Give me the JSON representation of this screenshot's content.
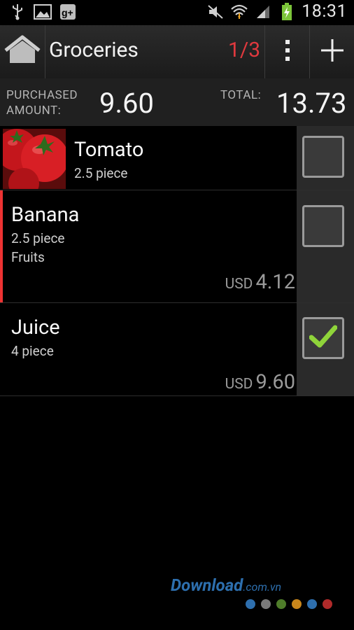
{
  "statusbar": {
    "time": "18:31",
    "left_icons": [
      "usb-icon",
      "image-icon",
      "google-plus-icon"
    ],
    "right_icons": [
      "mute-icon",
      "wifi-icon",
      "signal-icon",
      "battery-icon"
    ]
  },
  "actionbar": {
    "title": "Groceries",
    "counter": "1/3",
    "home_icon": "home-icon",
    "menu_icon": "overflow-menu-icon",
    "add_icon": "add-icon"
  },
  "summary": {
    "purchased_label_line1": "PURCHASED",
    "purchased_label_line2": "AMOUNT:",
    "purchased_value": "9.60",
    "total_label": "TOTAL:",
    "total_value": "13.73"
  },
  "items": [
    {
      "name": "Tomato",
      "quantity": "2.5 piece",
      "category": "",
      "currency": "",
      "price": "",
      "checked": false,
      "has_image": true
    },
    {
      "name": "Banana",
      "quantity": "2.5 piece",
      "category": "Fruits",
      "currency": "USD",
      "price": "4.12",
      "checked": false,
      "has_image": false
    },
    {
      "name": "Juice",
      "quantity": "4 piece",
      "category": "",
      "currency": "USD",
      "price": "9.60",
      "checked": true,
      "has_image": false
    }
  ],
  "watermark": {
    "text": "Download",
    "suffix": ".com.vn",
    "dot_colors": [
      "#2e6fae",
      "#7a7a7a",
      "#4f7d2a",
      "#c9861b",
      "#2e6fae",
      "#b02a2a"
    ]
  },
  "colors": {
    "accent_red": "#e0393e",
    "check_green": "#8fd43a"
  }
}
